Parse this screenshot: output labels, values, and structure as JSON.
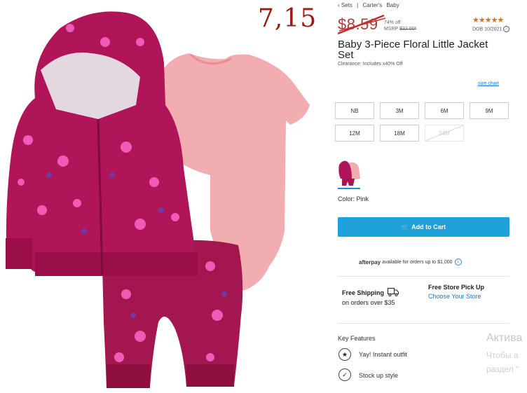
{
  "overlay": {
    "handwritten_price": "7,15"
  },
  "breadcrumb": {
    "back": "‹ Sets",
    "separator": "|",
    "brand": "Carter's",
    "category": "Baby"
  },
  "pricing": {
    "old_price": "$8.59",
    "discount": "74% off",
    "msrp_label": "MSRP",
    "msrp_value": "$32.00*"
  },
  "rating": {
    "stars": "★★★★★",
    "dob": "DOB 10/2021",
    "accent": "#c57a1f"
  },
  "product": {
    "title": "Baby 3-Piece Floral Little Jacket Set",
    "clearance_note": "Clearance: Includes x40% Off",
    "size_chart": "size chart"
  },
  "sizes": [
    {
      "label": "NB",
      "available": true
    },
    {
      "label": "3M",
      "available": true
    },
    {
      "label": "6M",
      "available": true
    },
    {
      "label": "9M",
      "available": true
    },
    {
      "label": "12M",
      "available": true
    },
    {
      "label": "18M",
      "available": true
    },
    {
      "label": "24M",
      "available": false
    }
  ],
  "color": {
    "label": "Color: Pink",
    "swatch_icon": "outfit-thumbnail"
  },
  "cart": {
    "button_label": "Add to Cart",
    "icon": "cart-icon",
    "accent": "#1ea0d8"
  },
  "afterpay": {
    "brand": "afterpay",
    "text": "available for orders up to $1,000"
  },
  "shipping": {
    "free_title": "Free Shipping",
    "free_sub": "on orders over $35",
    "pickup_title": "Free Store Pick Up",
    "pickup_link": "Choose Your Store"
  },
  "features": {
    "title": "Key Features",
    "items": [
      {
        "label": "Yay! Instant outfit",
        "icon": "star-badge-icon"
      },
      {
        "label": "Stock up style",
        "icon": "check-badge-icon"
      }
    ]
  },
  "watermark": {
    "line1": "Актива",
    "line2": "Чтобы а",
    "line3": "раздел \""
  }
}
